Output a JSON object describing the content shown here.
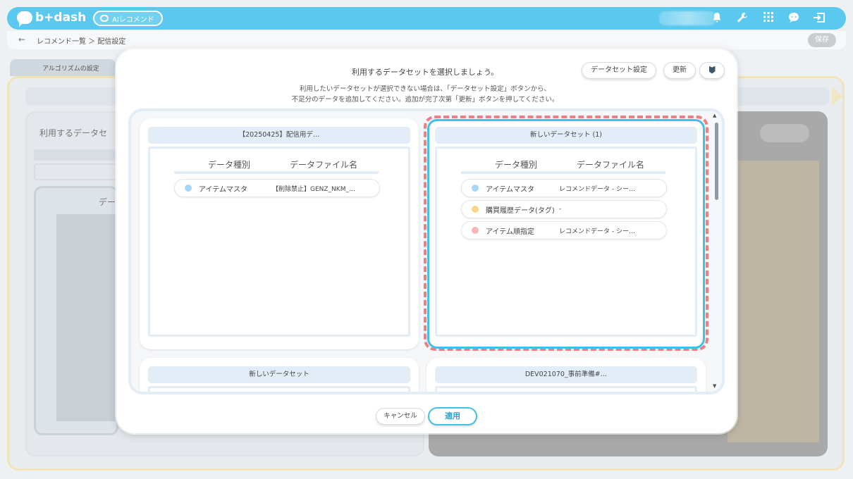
{
  "header": {
    "logo_text": "b+dash",
    "app_chip_label": "AIレコメンド",
    "icons": [
      "bell-icon",
      "wrench-icon",
      "grid-icon",
      "support-icon",
      "logout-icon"
    ]
  },
  "breadcrumb": {
    "back": "←",
    "path": "レコメンド一覧 ＞ 配信設定",
    "save_label": "保存"
  },
  "background_page": {
    "tab_label": "アルゴリズムの設定",
    "section_title": "利用するデータセ",
    "inner_label": "デー"
  },
  "modal": {
    "title": "利用するデータセットを選択しましょう。",
    "description_line1": "利用したいデータセットが選択できない場合は、「データセット設定」ボタンから、",
    "description_line2": "不足分のデータを追加してください。追加が完了次第「更新」ボタンを押してください。",
    "dataset_setting_button": "データセット設定",
    "refresh_button": "更新",
    "cancel_button": "キャンセル",
    "apply_button": "適用",
    "column_type": "データ種別",
    "column_file": "データファイル名",
    "datasets": [
      {
        "name": "【20250425】配信用デ…",
        "rows": [
          {
            "type": "アイテムマスタ",
            "file": "【削除禁止】GENZ_NKM_…",
            "color": "#a9d6f5"
          }
        ]
      },
      {
        "name": "新しいデータセット (1)",
        "selected": true,
        "rows": [
          {
            "type": "アイテムマスタ",
            "file": "レコメンドデータ - シー…",
            "color": "#a9d6f5"
          },
          {
            "type": "購買履歴データ(タグ)",
            "file": "-",
            "color": "#fbd681"
          },
          {
            "type": "アイテム順指定",
            "file": "レコメンドデータ - シー…",
            "color": "#f8b8b0"
          }
        ]
      },
      {
        "name": "新しいデータセット",
        "rows": []
      },
      {
        "name": "DEV021070_事前準備#…",
        "rows": []
      }
    ]
  }
}
